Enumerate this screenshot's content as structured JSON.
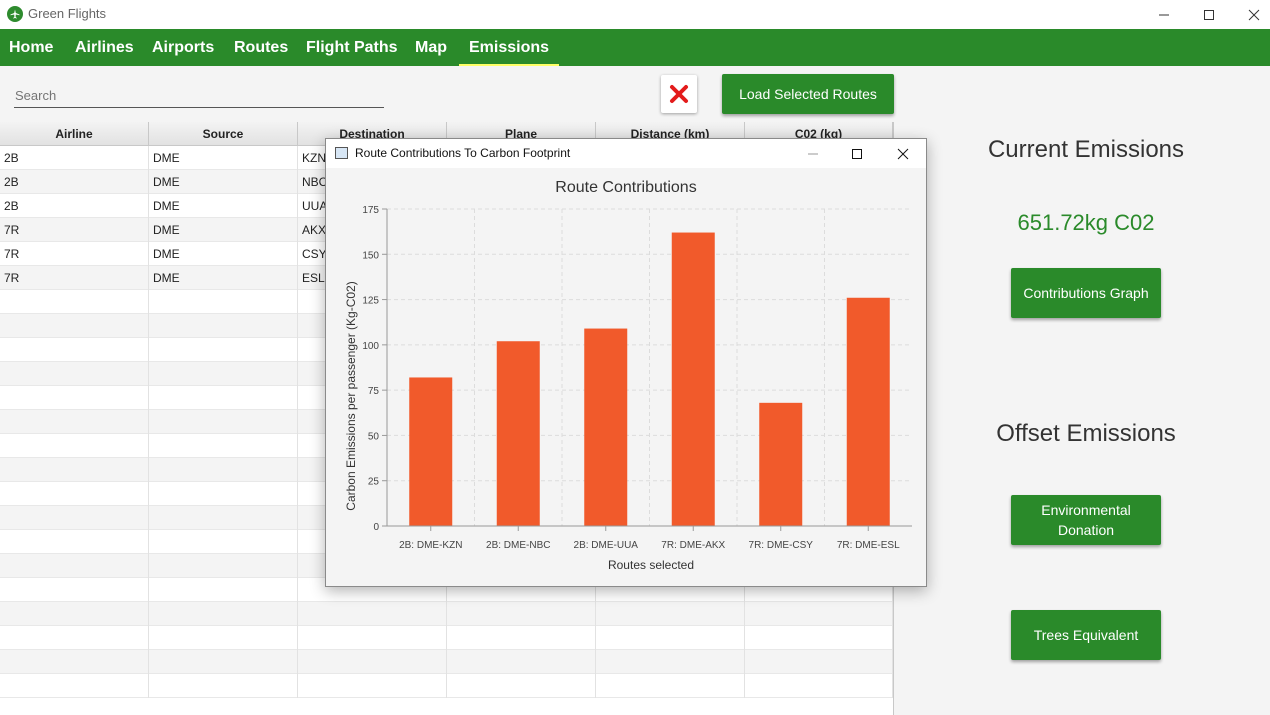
{
  "window": {
    "title": "Green Flights"
  },
  "menu": [
    {
      "label": "Home",
      "active": false
    },
    {
      "label": "Airlines",
      "active": false
    },
    {
      "label": "Airports",
      "active": false
    },
    {
      "label": "Routes",
      "active": false
    },
    {
      "label": "Flight Paths",
      "active": false
    },
    {
      "label": "Map",
      "active": false
    },
    {
      "label": "Emissions",
      "active": true
    }
  ],
  "search": {
    "placeholder": "Search",
    "value": ""
  },
  "buttons": {
    "load_selected": "Load Selected Routes"
  },
  "table": {
    "columns": [
      "Airline",
      "Source",
      "Destination",
      "Plane",
      "Distance (km)",
      "C02 (kg)"
    ],
    "rows": [
      [
        "2B",
        "DME",
        "KZN",
        "",
        "",
        ""
      ],
      [
        "2B",
        "DME",
        "NBC",
        "",
        "",
        ""
      ],
      [
        "2B",
        "DME",
        "UUA",
        "",
        "",
        ""
      ],
      [
        "7R",
        "DME",
        "AKX",
        "",
        "",
        ""
      ],
      [
        "7R",
        "DME",
        "CSY",
        "",
        "",
        ""
      ],
      [
        "7R",
        "DME",
        "ESL",
        "",
        "",
        ""
      ]
    ]
  },
  "right_panel": {
    "current_heading": "Current Emissions",
    "current_value": "651.72kg C02",
    "contributions_button": "Contributions Graph",
    "offset_heading": "Offset Emissions",
    "donation_button": "Environmental Donation",
    "trees_button": "Trees Equivalent"
  },
  "dialog": {
    "title": "Route Contributions To Carbon Footprint"
  },
  "colors": {
    "primary": "#2a8a2a",
    "bar": "#f15a2b",
    "active_tab_underline": "#ffff66"
  },
  "chart_data": {
    "type": "bar",
    "title": "Route Contributions",
    "xlabel": "Routes selected",
    "ylabel": "Carbon Emissions per passenger (Kg-C02)",
    "categories": [
      "2B: DME-KZN",
      "2B: DME-NBC",
      "2B: DME-UUA",
      "7R: DME-AKX",
      "7R: DME-CSY",
      "7R: DME-ESL"
    ],
    "values": [
      82,
      102,
      109,
      162,
      68,
      126
    ],
    "ylim": [
      0,
      175
    ],
    "yticks": [
      0,
      25,
      50,
      75,
      100,
      125,
      150,
      175
    ],
    "grid": true,
    "legend": "none"
  }
}
